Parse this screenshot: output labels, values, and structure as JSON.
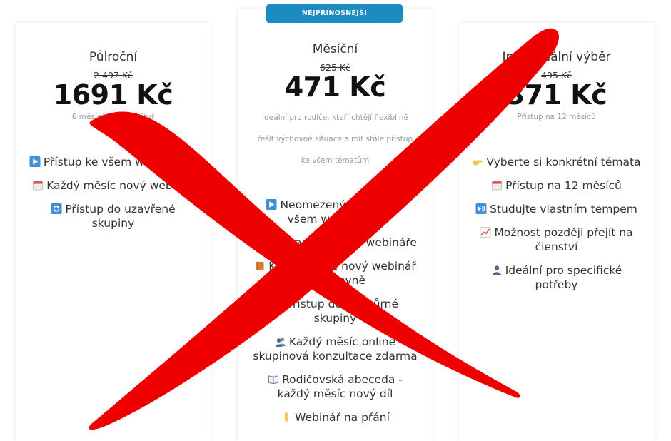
{
  "colors": {
    "badge": "#1b8bc2",
    "cross": "#ee0000",
    "price": "#111111",
    "muted": "#9a9a9a"
  },
  "cards": [
    {
      "name": "Půlroční",
      "old_price": "2 497 Kč",
      "price": "1691 Kč",
      "subtitle": "6 měsíců za cenu čtyř",
      "features": [
        {
          "icon": "play-button-icon",
          "text": "Přístup ke všem webinářům"
        },
        {
          "icon": "calendar-icon",
          "text": "Každý měsíc nový webinář"
        },
        {
          "icon": "refresh-icon",
          "text": "Přístup do uzavřené skupiny"
        }
      ]
    },
    {
      "badge": "NEJPŘÍNOSNĚJŠÍ",
      "name": "Měsíční",
      "old_price": "625 Kč",
      "price": "471 Kč",
      "desc_lines": [
        "Ideální pro rodiče, kteří chtějí flexibilně",
        "řešit výchovné situace a mít stále přístup",
        "ke všem tématům"
      ],
      "features": [
        {
          "icon": "play-button-icon",
          "text": "Neomezený přístup ke všem webinářům"
        },
        {
          "icon": "notes-icon",
          "text": "Záznam každého webináře"
        },
        {
          "icon": "book-icon",
          "text": "Každý měsíc nový webinář v knihovně"
        },
        {
          "icon": "refresh-icon",
          "text": "Přístup do podpůrné skupiny"
        },
        {
          "icon": "people-icon",
          "text": "Každý měsíc online skupinová konzultace zdarma"
        },
        {
          "icon": "open-book-icon",
          "text": "Rodičovská abeceda - každý měsíc nový díl"
        },
        {
          "icon": "hand-icon",
          "text": "Webinář na přání"
        }
      ]
    },
    {
      "name": "Individuální výběr",
      "old_price": "495 Kč",
      "price": "371 Kč",
      "subtitle": "Přístup na 12 měsíců",
      "features": [
        {
          "icon": "pointing-hand-icon",
          "text": "Vyberte si konkrétní témata"
        },
        {
          "icon": "calendar-icon",
          "text": "Přístup na 12 měsíců"
        },
        {
          "icon": "play-pause-icon",
          "text": "Studujte vlastním tempem"
        },
        {
          "icon": "chart-increasing-icon",
          "text": "Možnost později přejít na členství"
        },
        {
          "icon": "person-icon",
          "text": "Ideální pro specifické potřeby"
        }
      ]
    }
  ]
}
